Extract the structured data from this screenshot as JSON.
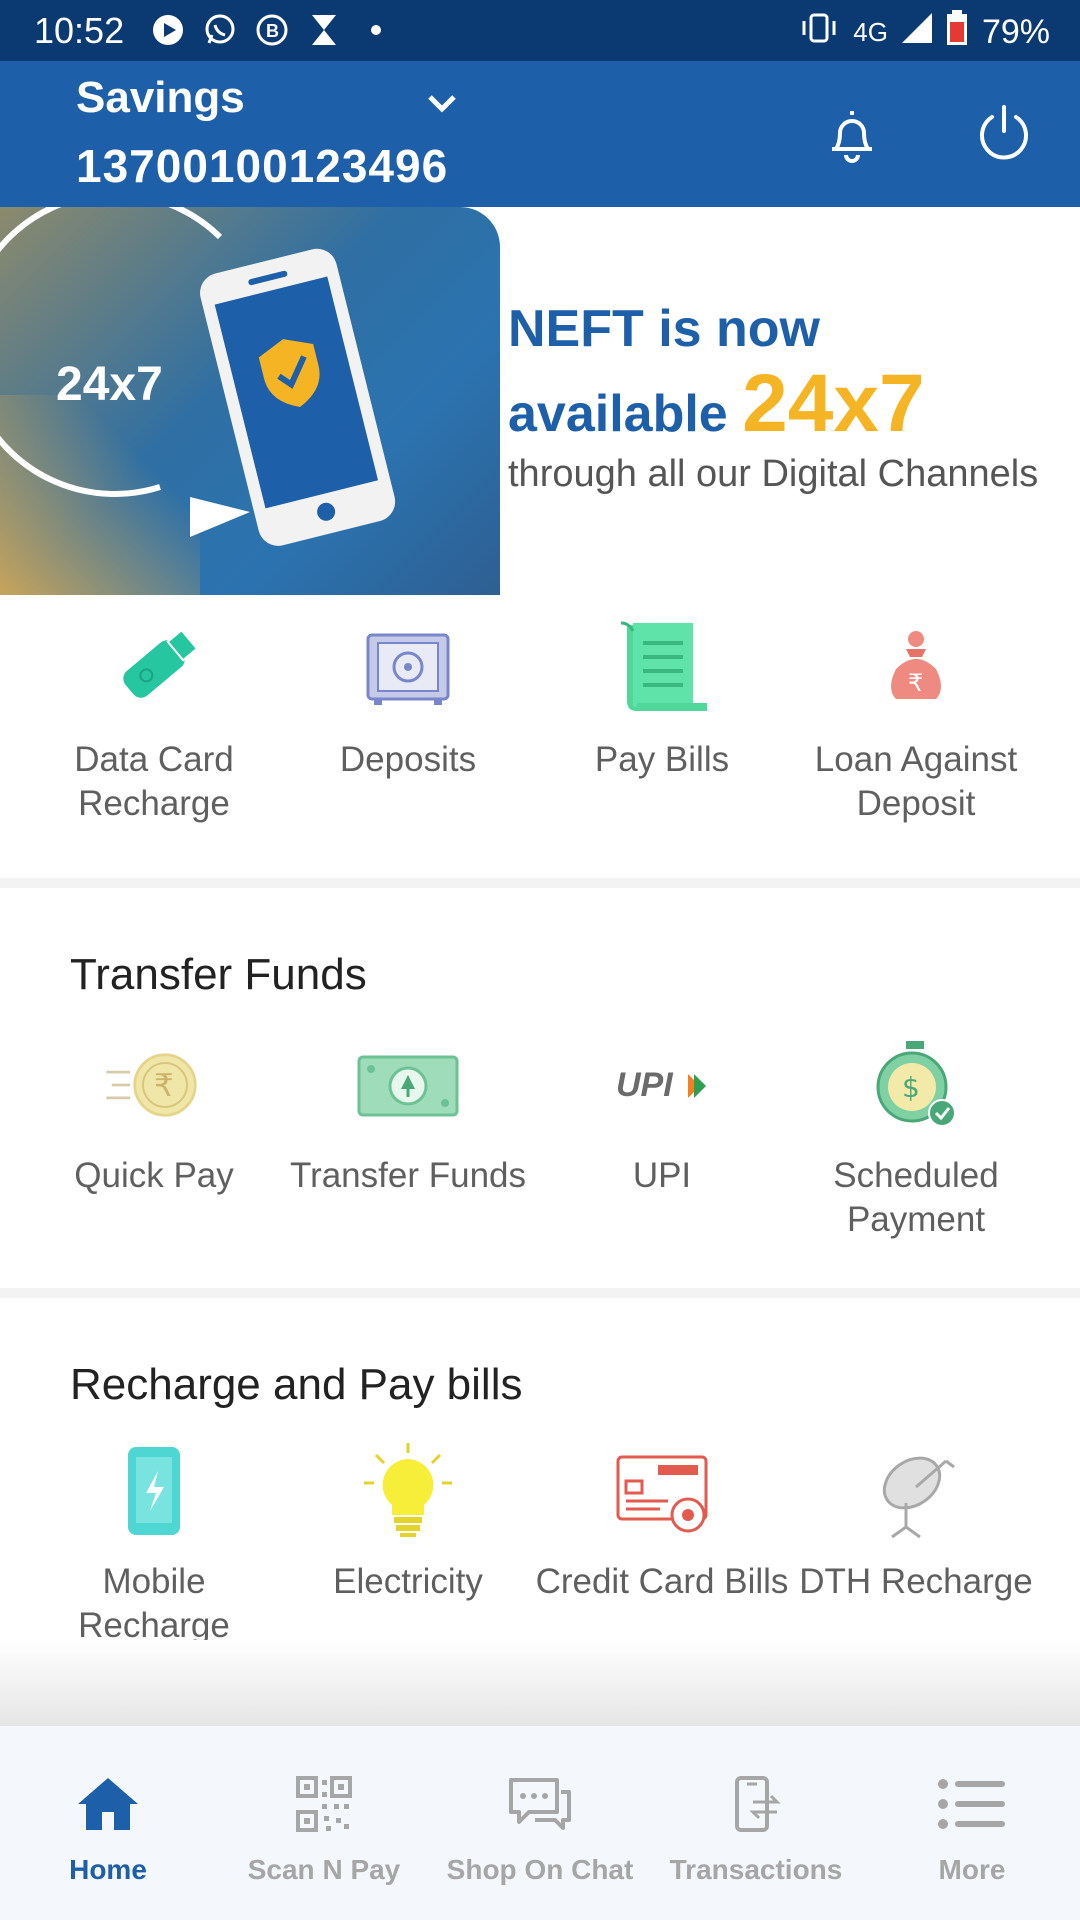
{
  "status": {
    "time": "10:52",
    "network": "4G",
    "battery": "79%"
  },
  "account": {
    "type": "Savings",
    "number": "13700100123496"
  },
  "banner": {
    "badge": "24x7",
    "line1": "NEFT is now",
    "line2": "available",
    "line2_accent": "24x7",
    "subline": "through all our Digital Channels"
  },
  "quick_tiles": [
    {
      "label": "Data Card Recharge",
      "icon": "usb-dongle-icon"
    },
    {
      "label": "Deposits",
      "icon": "safe-vault-icon"
    },
    {
      "label": "Pay Bills",
      "icon": "bill-scroll-icon"
    },
    {
      "label": "Loan Against Deposit",
      "icon": "money-bag-icon"
    }
  ],
  "transfer": {
    "title": "Transfer Funds",
    "items": [
      {
        "label": "Quick Pay",
        "icon": "rupee-coin-icon"
      },
      {
        "label": "Transfer Funds",
        "icon": "banknote-icon"
      },
      {
        "label": "UPI",
        "icon": "upi-logo-icon"
      },
      {
        "label": "Scheduled Payment",
        "icon": "stopwatch-dollar-icon"
      }
    ]
  },
  "recharge": {
    "title": "Recharge and Pay bills",
    "items": [
      {
        "label": "Mobile Recharge",
        "icon": "mobile-phone-icon"
      },
      {
        "label": "Electricity",
        "icon": "light-bulb-icon"
      },
      {
        "label": "Credit Card Bills",
        "icon": "credit-card-icon"
      },
      {
        "label": "DTH Recharge",
        "icon": "satellite-dish-icon"
      }
    ]
  },
  "nav": [
    {
      "label": "Home",
      "icon": "home-icon",
      "active": true
    },
    {
      "label": "Scan N Pay",
      "icon": "qr-code-icon",
      "active": false
    },
    {
      "label": "Shop On Chat",
      "icon": "chat-bubbles-icon",
      "active": false
    },
    {
      "label": "Transactions",
      "icon": "phone-transfer-icon",
      "active": false
    },
    {
      "label": "More",
      "icon": "menu-list-icon",
      "active": false
    }
  ],
  "colors": {
    "primary": "#1d5fa8",
    "statusbar": "#0b3a73",
    "accent": "#f4b423"
  }
}
